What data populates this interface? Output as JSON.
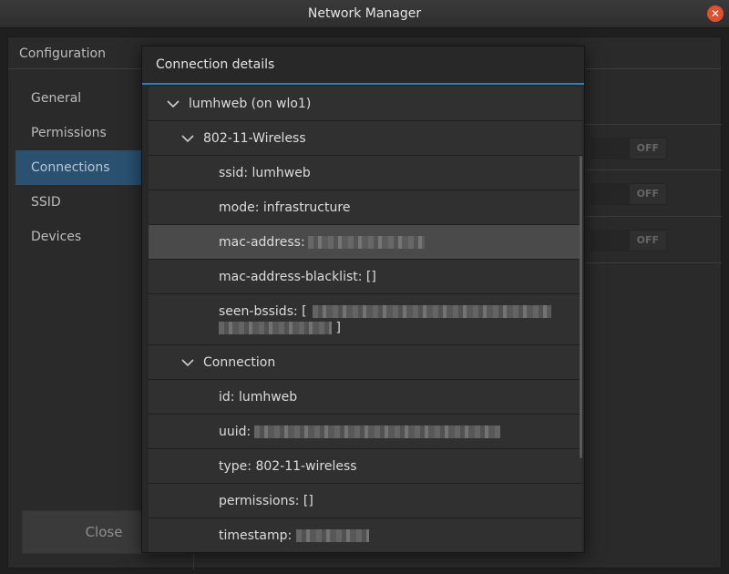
{
  "window": {
    "title": "Network Manager",
    "close_glyph": "✕"
  },
  "config": {
    "header": "Configuration",
    "sidebar": [
      {
        "label": "General"
      },
      {
        "label": "Permissions"
      },
      {
        "label": "Connections"
      },
      {
        "label": "SSID"
      },
      {
        "label": "Devices"
      }
    ],
    "close_button": "Close",
    "toggles": [
      {
        "label": "OFF"
      },
      {
        "label": "OFF"
      },
      {
        "label": "OFF"
      }
    ]
  },
  "dialog": {
    "title": "Connection details",
    "rows": [
      {
        "text": "lumhweb (on wlo1)"
      },
      {
        "text": "802-11-Wireless"
      },
      {
        "text": "ssid: lumhweb"
      },
      {
        "text": "mode: infrastructure"
      },
      {
        "text": "mac-address:"
      },
      {
        "text": "mac-address-blacklist: []"
      },
      {
        "text": "seen-bssids: ["
      },
      {
        "text": "]"
      },
      {
        "text": "Connection"
      },
      {
        "text": "id: lumhweb"
      },
      {
        "text": "uuid:"
      },
      {
        "text": "type: 802-11-wireless"
      },
      {
        "text": "permissions: []"
      },
      {
        "text": "timestamp:"
      }
    ]
  },
  "colors": {
    "accent": "#2f7fb3",
    "active_sidebar": "#2a5170",
    "close_button": "#e0502c"
  }
}
